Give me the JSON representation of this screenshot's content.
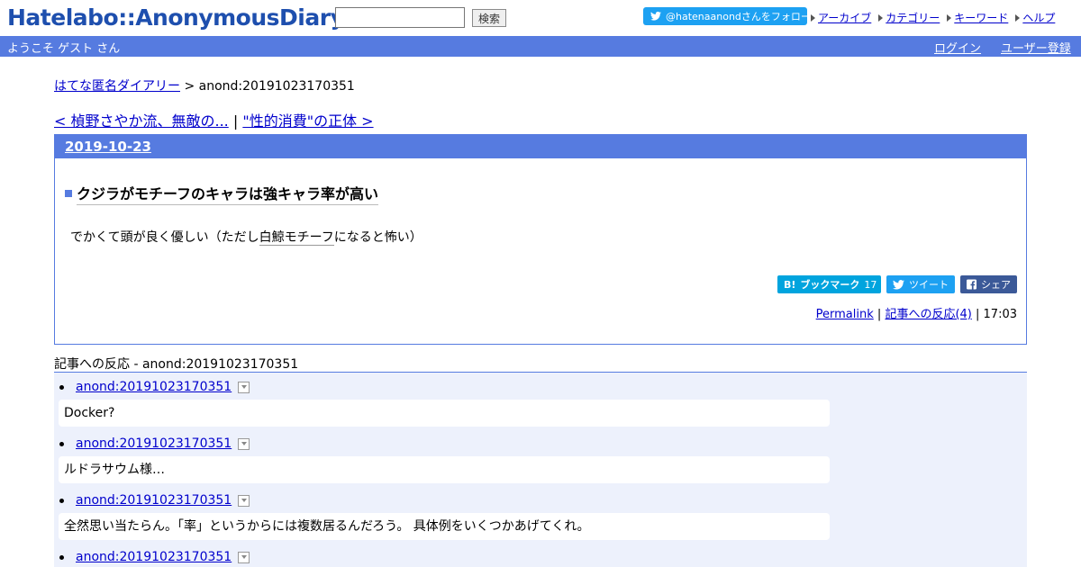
{
  "header": {
    "logo": "Hatelabo::AnonymousDiary",
    "search_button": "検索",
    "follow_label": "@hatenaanondさんをフォロー",
    "nav": [
      {
        "label": "アーカイブ"
      },
      {
        "label": "カテゴリー"
      },
      {
        "label": "キーワード"
      },
      {
        "label": "ヘルプ"
      }
    ]
  },
  "welcome": {
    "text": "ようこそ ゲスト さん",
    "login": "ログイン",
    "signup": "ユーザー登録"
  },
  "breadcrumb": {
    "home": "はてな匿名ダイアリー",
    "separator": ">",
    "current": "anond:20191023170351"
  },
  "pager": {
    "prev": "< 楨野さやか流、無敵の...",
    "separator": "|",
    "next": "\"性的消費\"の正体 >"
  },
  "entry": {
    "date": "2019-10-23",
    "title": "クジラがモチーフのキャラは強キャラ率が高い",
    "body_before": "でかくて頭が良く優しい（ただし",
    "body_keyword": "白鯨モチーフ",
    "body_after": "になると怖い）",
    "bookmark_label": "ブックマーク",
    "bookmark_b": "B!",
    "bookmark_count": "17",
    "tweet_label": "ツイート",
    "share_label": "シェア",
    "permalink": "Permalink",
    "reactions_link": "記事への反応(4)",
    "footer_sep": "|",
    "time": "17:03"
  },
  "reactions": {
    "title": "記事への反応 - anond:20191023170351",
    "items": [
      {
        "id": "anond:20191023170351",
        "text": "Docker?"
      },
      {
        "id": "anond:20191023170351",
        "text": "ルドラサウム様…"
      },
      {
        "id": "anond:20191023170351",
        "text": "全然思い当たらん。「率」というからには複数居るんだろう。 具体例をいくつかあげてくれ。"
      },
      {
        "id": "anond:20191023170351",
        "text": ""
      }
    ]
  },
  "colors": {
    "brand_blue": "#567be0",
    "logo_blue": "#1e4fae",
    "twitter": "#1da1f2",
    "hatena_bookmark": "#00a4de",
    "facebook": "#3b5998",
    "reaction_bg": "#edf1fc"
  },
  "icons": [
    "twitter-bird-icon",
    "nav-arrow-icon",
    "menu-toggle-icon",
    "facebook-icon",
    "title-bullet-icon"
  ]
}
